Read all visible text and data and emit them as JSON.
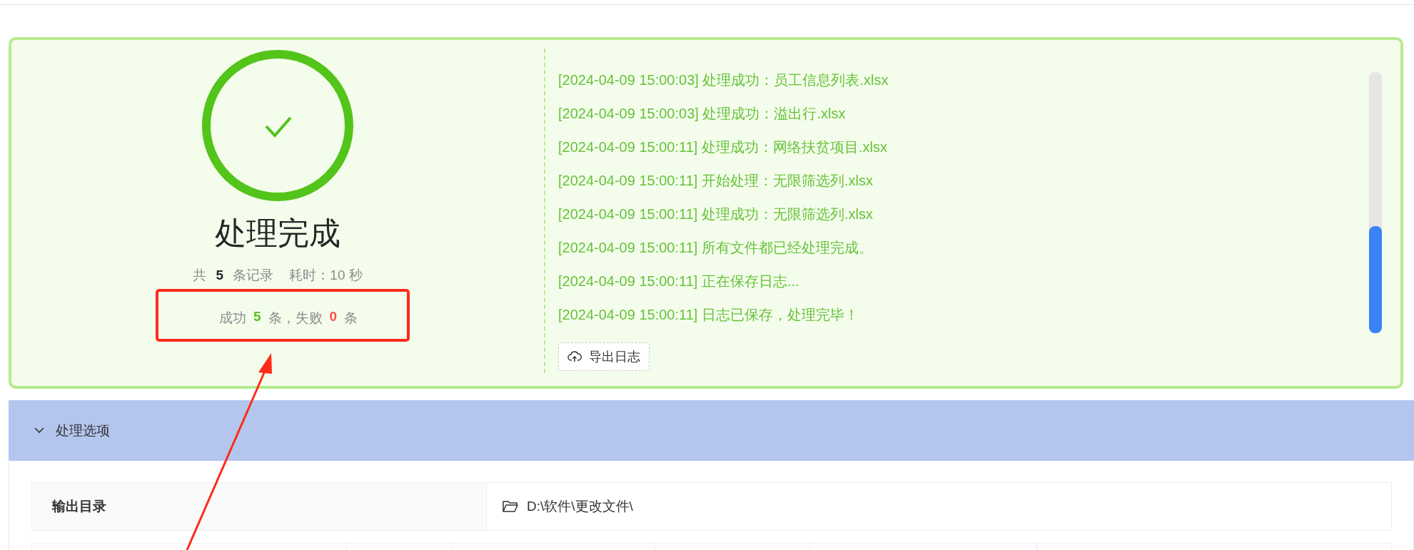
{
  "result": {
    "title": "处理完成",
    "summary": "共 **5** 条记录",
    "duration": "耗时：10 秒",
    "counts": [
      {
        "kind": "label",
        "text": "成功"
      },
      {
        "kind": "success",
        "text": "5"
      },
      {
        "kind": "label",
        "text": "条，失败"
      },
      {
        "kind": "fail",
        "text": "0"
      },
      {
        "kind": "label",
        "text": "条"
      }
    ]
  },
  "log": {
    "lines": [
      "[2024-04-09 15:00:03] 处理成功：员工信息列表.xlsx",
      "[2024-04-09 15:00:03] 处理成功：溢出行.xlsx",
      "[2024-04-09 15:00:11] 处理成功：网络扶贫项目.xlsx",
      "[2024-04-09 15:00:11] 开始处理：无限筛选列.xlsx",
      "[2024-04-09 15:00:11] 处理成功：无限筛选列.xlsx",
      "[2024-04-09 15:00:11] 所有文件都已经处理完成。",
      "[2024-04-09 15:00:11] 正在保存日志...",
      "[2024-04-09 15:00:11] 日志已保存，处理完毕！"
    ],
    "export_button": "导出日志"
  },
  "options": {
    "title": "处理选项",
    "expanded": true,
    "rows": [
      {
        "label": "输出目录",
        "value": "D:\\软件\\更改文件\\"
      }
    ]
  }
}
